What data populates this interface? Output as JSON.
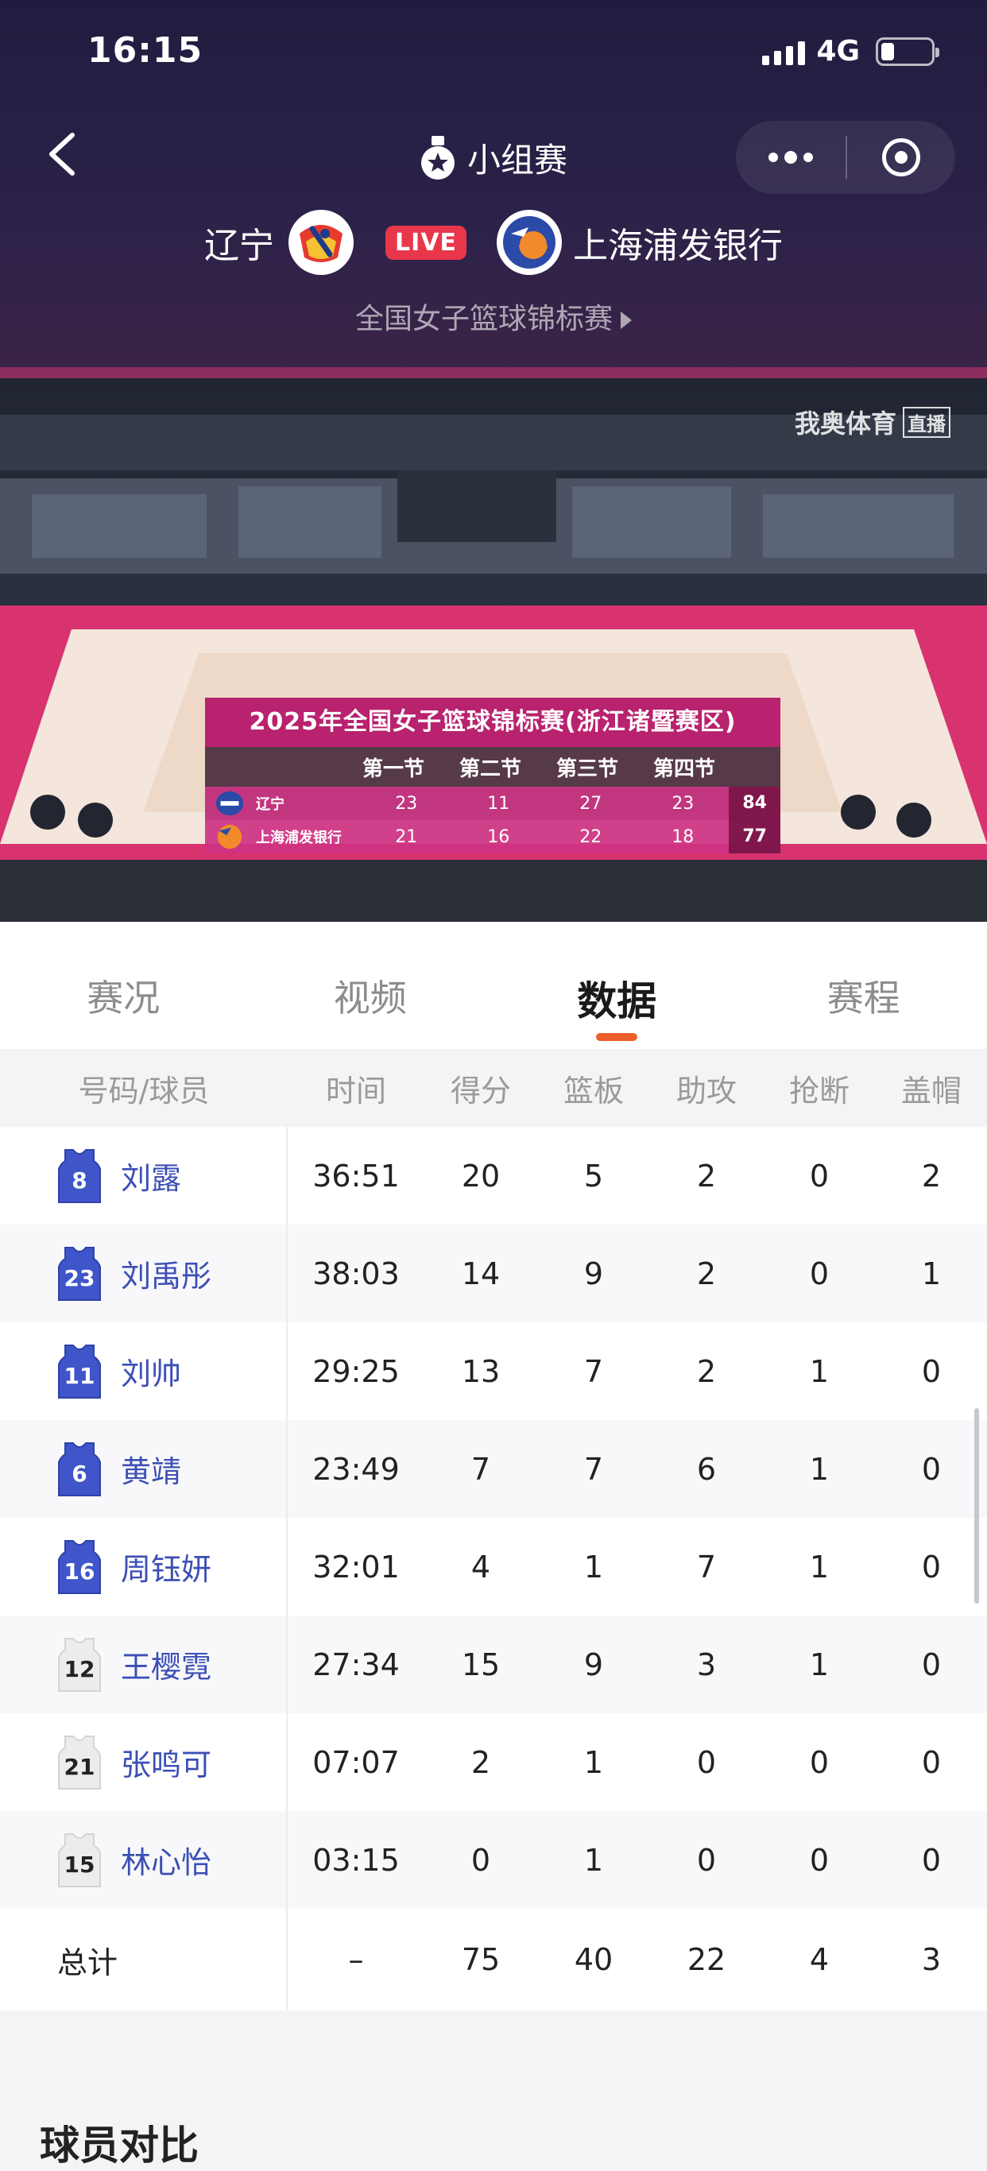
{
  "status_bar": {
    "time": "16:15",
    "network": "4G"
  },
  "header": {
    "round": "小组赛",
    "home_team": "辽宁",
    "live_label": "LIVE",
    "away_team": "上海浦发银行",
    "competition": "全国女子篮球锦标赛"
  },
  "video": {
    "watermark": "我奥体育",
    "watermark_tag": "直播",
    "scoreboard": {
      "title": "2025年全国女子篮球锦标赛(浙江诸暨赛区)",
      "quarters": [
        "第一节",
        "第二节",
        "第三节",
        "第四节"
      ],
      "rows": [
        {
          "team": "辽宁",
          "q": [
            "23",
            "11",
            "27",
            "23"
          ],
          "total": "84"
        },
        {
          "team": "上海浦发银行",
          "q": [
            "21",
            "16",
            "22",
            "18"
          ],
          "total": "77"
        }
      ]
    }
  },
  "tabs": [
    {
      "label": "赛况",
      "active": false
    },
    {
      "label": "视频",
      "active": false
    },
    {
      "label": "数据",
      "active": true
    },
    {
      "label": "赛程",
      "active": false
    }
  ],
  "table": {
    "headers": [
      "号码/球员",
      "时间",
      "得分",
      "篮板",
      "助攻",
      "抢断",
      "盖帽"
    ],
    "players": [
      {
        "number": "8",
        "name": "刘露",
        "starter": true,
        "time": "36:51",
        "pts": "20",
        "reb": "5",
        "ast": "2",
        "stl": "0",
        "blk": "2"
      },
      {
        "number": "23",
        "name": "刘禹彤",
        "starter": true,
        "time": "38:03",
        "pts": "14",
        "reb": "9",
        "ast": "2",
        "stl": "0",
        "blk": "1"
      },
      {
        "number": "11",
        "name": "刘帅",
        "starter": true,
        "time": "29:25",
        "pts": "13",
        "reb": "7",
        "ast": "2",
        "stl": "1",
        "blk": "0"
      },
      {
        "number": "6",
        "name": "黄靖",
        "starter": true,
        "time": "23:49",
        "pts": "7",
        "reb": "7",
        "ast": "6",
        "stl": "1",
        "blk": "0"
      },
      {
        "number": "16",
        "name": "周钰妍",
        "starter": true,
        "time": "32:01",
        "pts": "4",
        "reb": "1",
        "ast": "7",
        "stl": "1",
        "blk": "0"
      },
      {
        "number": "12",
        "name": "王樱霓",
        "starter": false,
        "time": "27:34",
        "pts": "15",
        "reb": "9",
        "ast": "3",
        "stl": "1",
        "blk": "0"
      },
      {
        "number": "21",
        "name": "张鸣可",
        "starter": false,
        "time": "07:07",
        "pts": "2",
        "reb": "1",
        "ast": "0",
        "stl": "0",
        "blk": "0"
      },
      {
        "number": "15",
        "name": "林心怡",
        "starter": false,
        "time": "03:15",
        "pts": "0",
        "reb": "1",
        "ast": "0",
        "stl": "0",
        "blk": "0"
      }
    ],
    "total": {
      "label": "总计",
      "time": "–",
      "pts": "75",
      "reb": "40",
      "ast": "22",
      "stl": "4",
      "blk": "3"
    }
  },
  "next_section_title": "球员对比",
  "colors": {
    "accent": "#ee5f2c",
    "live": "#e8374a",
    "player_link": "#3c4fb5",
    "jersey_blue": "#3f55c9"
  }
}
